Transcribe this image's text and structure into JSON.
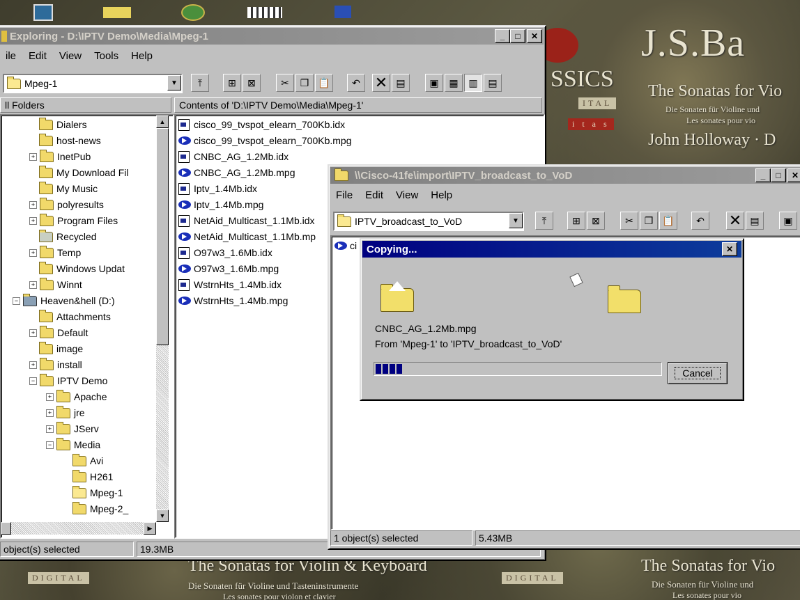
{
  "background_art": {
    "title_right": "J.S.Ba",
    "subtitle_right": "The Sonatas for Vio",
    "german_right": "Die Sonaten für Violine und",
    "french_right": "Les sonates pour vio",
    "artist_right": "John Holloway · D",
    "bottom_title": "The Sonatas for Violin & Keyboard",
    "bottom_german": "Die Sonaten für Violine und Tasteninstrumente",
    "bottom_french": "Les sonates pour violon et clavier",
    "bottom_right_title": "The Sonatas for Vio",
    "bottom_right_german": "Die Sonaten für Violine und",
    "bottom_right_french": "Les sonates pour vio",
    "digital_label": "DIGITAL",
    "logo_text": "SSICS",
    "logo_text2": "ITAL",
    "logo_text3": "i t a s"
  },
  "explorer": {
    "title": "Exploring - D:\\IPTV Demo\\Media\\Mpeg-1",
    "menu": [
      "ile",
      "Edit",
      "View",
      "Tools",
      "Help"
    ],
    "address_value": "Mpeg-1",
    "folders_header": "ll Folders",
    "contents_header": "Contents of 'D:\\IPTV Demo\\Media\\Mpeg-1'",
    "tree": [
      {
        "label": "Dialers",
        "indent": 3,
        "plus": false
      },
      {
        "label": "host-news",
        "indent": 3,
        "plus": false
      },
      {
        "label": "InetPub",
        "indent": 3,
        "plus": true
      },
      {
        "label": "My Download Fil",
        "indent": 3,
        "plus": false
      },
      {
        "label": "My Music",
        "indent": 3,
        "plus": false
      },
      {
        "label": "polyresults",
        "indent": 3,
        "plus": true
      },
      {
        "label": "Program Files",
        "indent": 3,
        "plus": true
      },
      {
        "label": "Recycled",
        "indent": 3,
        "plus": false
      },
      {
        "label": "Temp",
        "indent": 3,
        "plus": true
      },
      {
        "label": "Windows Updat",
        "indent": 3,
        "plus": false
      },
      {
        "label": "Winnt",
        "indent": 3,
        "plus": true
      },
      {
        "label": "Heaven&hell (D:)",
        "indent": 1,
        "plus": "minus"
      },
      {
        "label": "Attachments",
        "indent": 3,
        "plus": false
      },
      {
        "label": "Default",
        "indent": 3,
        "plus": true
      },
      {
        "label": "image",
        "indent": 3,
        "plus": false
      },
      {
        "label": "install",
        "indent": 3,
        "plus": true
      },
      {
        "label": "IPTV Demo",
        "indent": 3,
        "plus": "minus"
      },
      {
        "label": "Apache",
        "indent": 5,
        "plus": true
      },
      {
        "label": "jre",
        "indent": 5,
        "plus": true
      },
      {
        "label": "JServ",
        "indent": 5,
        "plus": true
      },
      {
        "label": "Media",
        "indent": 5,
        "plus": "minus"
      },
      {
        "label": "Avi",
        "indent": 7,
        "plus": false
      },
      {
        "label": "H261",
        "indent": 7,
        "plus": false
      },
      {
        "label": "Mpeg-1",
        "indent": 7,
        "plus": false
      },
      {
        "label": "Mpeg-2_",
        "indent": 7,
        "plus": false
      }
    ],
    "files": [
      {
        "name": "cisco_99_tvspot_elearn_700Kb.idx",
        "type": "idx"
      },
      {
        "name": "cisco_99_tvspot_elearn_700Kb.mpg",
        "type": "mpg"
      },
      {
        "name": "CNBC_AG_1.2Mb.idx",
        "type": "idx"
      },
      {
        "name": "CNBC_AG_1.2Mb.mpg",
        "type": "mpg"
      },
      {
        "name": "Iptv_1.4Mb.idx",
        "type": "idx"
      },
      {
        "name": "Iptv_1.4Mb.mpg",
        "type": "mpg"
      },
      {
        "name": "NetAid_Multicast_1.1Mb.idx",
        "type": "idx"
      },
      {
        "name": "NetAid_Multicast_1.1Mb.mp",
        "type": "mpg"
      },
      {
        "name": "O97w3_1.6Mb.idx",
        "type": "idx"
      },
      {
        "name": "O97w3_1.6Mb.mpg",
        "type": "mpg"
      },
      {
        "name": "WstrnHts_1.4Mb.idx",
        "type": "idx"
      },
      {
        "name": "WstrnHts_1.4Mb.mpg",
        "type": "mpg"
      }
    ],
    "status_left": "object(s) selected",
    "status_size": "19.3MB"
  },
  "share_window": {
    "title": "\\\\Cisco-41fe\\import\\IPTV_broadcast_to_VoD",
    "menu": [
      "File",
      "Edit",
      "View",
      "Help"
    ],
    "address_value": "IPTV_broadcast_to_VoD",
    "partial_file": "ci",
    "status_left": "1 object(s) selected",
    "status_size": "5.43MB"
  },
  "copy_dialog": {
    "title": "Copying...",
    "filename": "CNBC_AG_1.2Mb.mpg",
    "from_to": "From 'Mpeg-1' to 'IPTV_broadcast_to_VoD'",
    "progress": 0.12,
    "cancel_label": "Cancel"
  },
  "colors": {
    "active_title": "#000080",
    "inactive_title": "#808080",
    "progress_block": "#000080",
    "window_face": "#c0c0c0"
  }
}
